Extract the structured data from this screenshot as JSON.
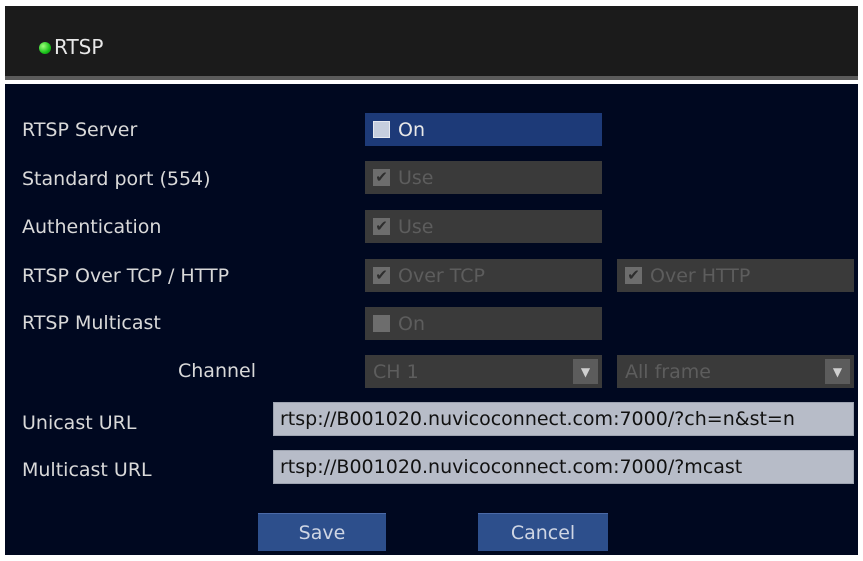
{
  "window": {
    "title": "RTSP",
    "status": "green-dot-icon"
  },
  "rows": {
    "rtsp_server": {
      "label": "RTSP Server",
      "option": "On",
      "checked": false,
      "enabled": true
    },
    "standard_port": {
      "label": "Standard port (554)",
      "option": "Use",
      "checked": true,
      "enabled": false
    },
    "authentication": {
      "label": "Authentication",
      "option": "Use",
      "checked": true,
      "enabled": false
    },
    "over_tcp_http": {
      "label": "RTSP Over TCP / HTTP",
      "option_tcp": "Over TCP",
      "option_http": "Over HTTP",
      "checked_tcp": true,
      "checked_http": true,
      "enabled": false
    },
    "multicast": {
      "label": "RTSP Multicast",
      "option": "On",
      "checked": false,
      "enabled": false
    },
    "channel": {
      "label": "Channel",
      "channel_value": "CH 1",
      "frame_value": "All frame",
      "enabled": false
    }
  },
  "urls": {
    "unicast_label": "Unicast URL",
    "unicast_value": "rtsp://B001020.nuvicoconnect.com:7000/?ch=n&st=n",
    "multicast_label": "Multicast URL",
    "multicast_value": "rtsp://B001020.nuvicoconnect.com:7000/?mcast"
  },
  "buttons": {
    "save": "Save",
    "cancel": "Cancel"
  },
  "icons": {
    "check": "✔",
    "dropdown": "▼"
  },
  "colors": {
    "panel_bg": "#000820",
    "enabled_control": "#1d3a78",
    "disabled_control": "#3a3a3a",
    "button": "#2d4f8c"
  }
}
